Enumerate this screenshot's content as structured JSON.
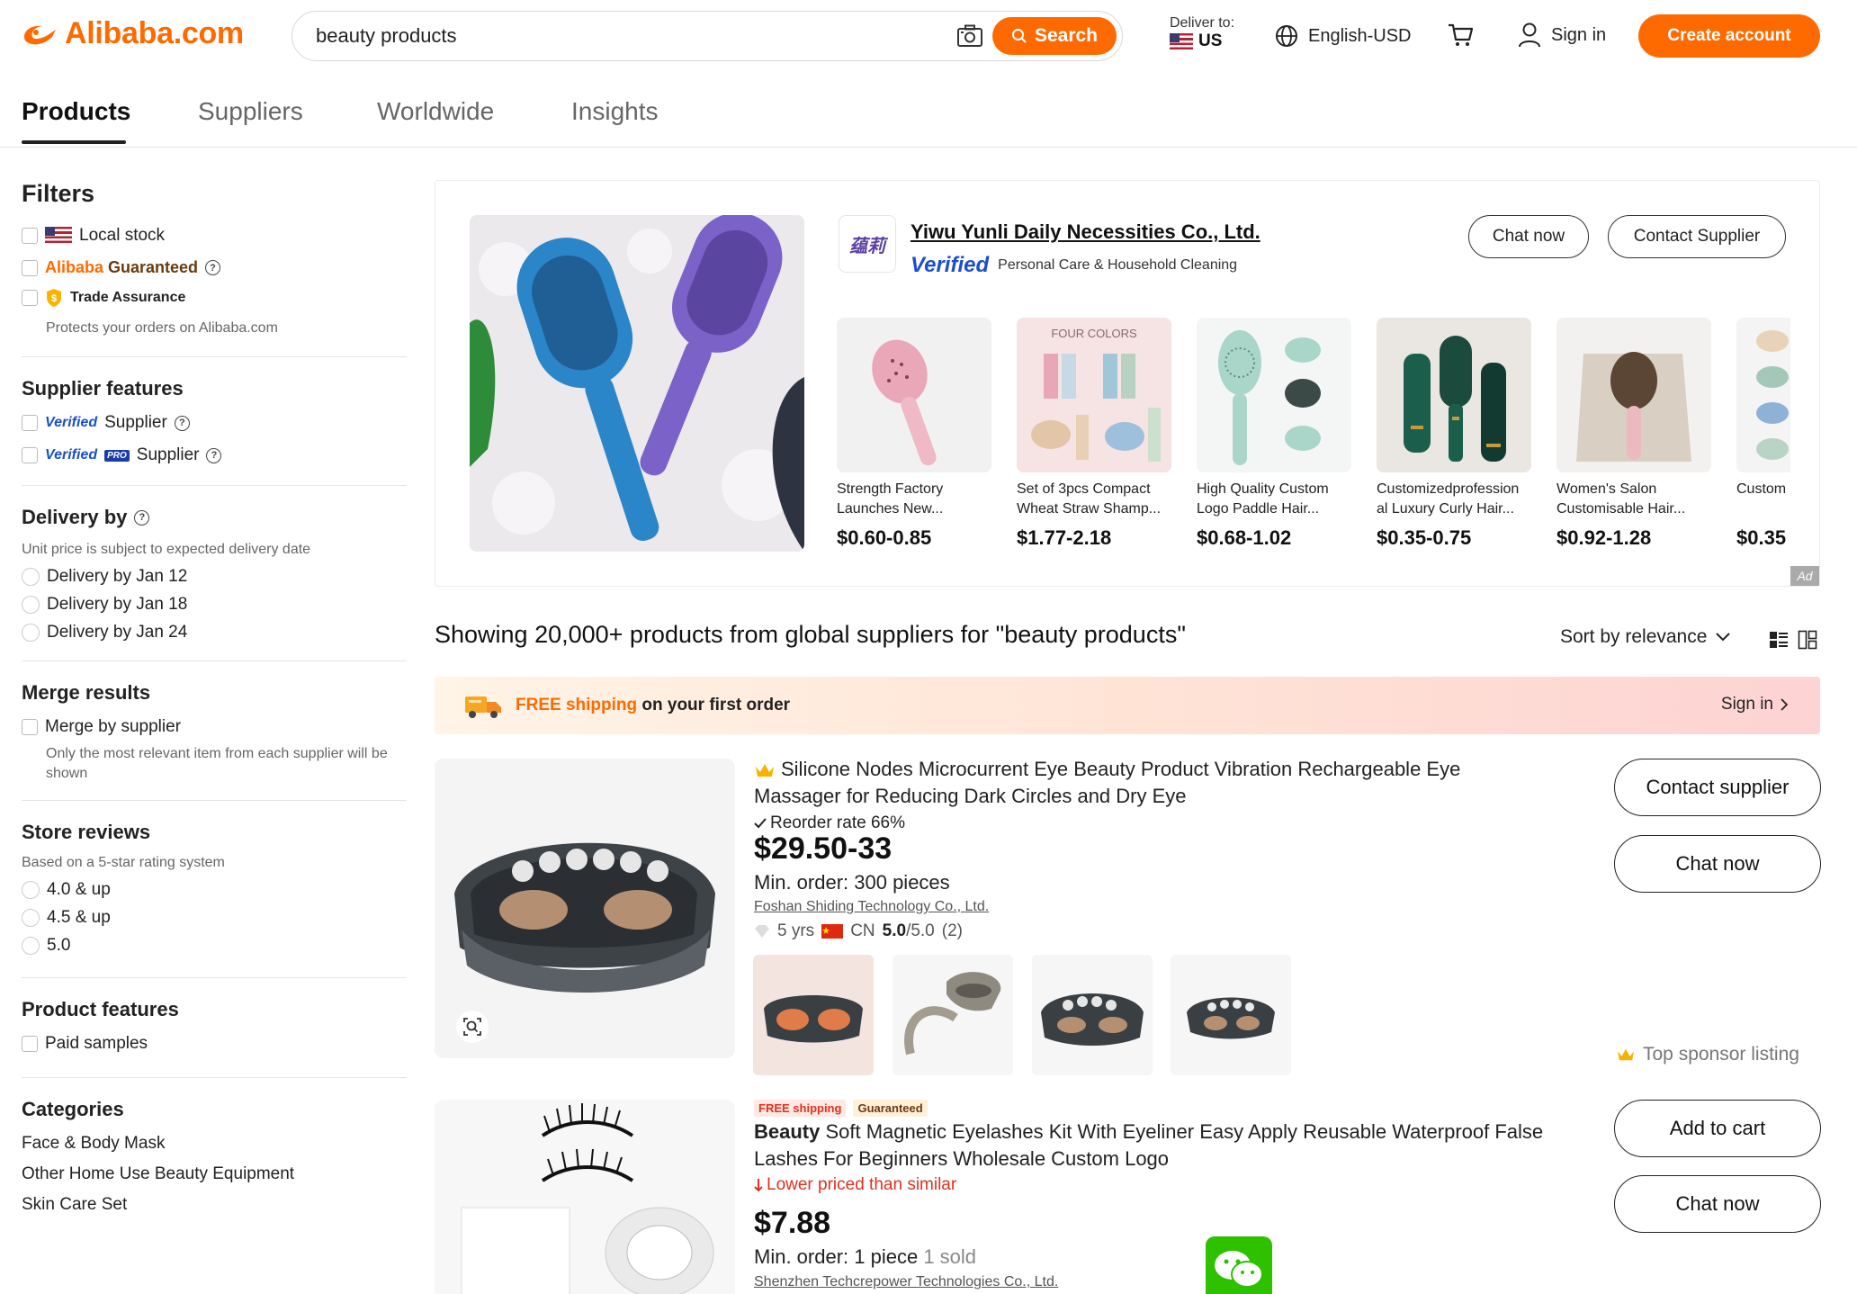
{
  "header": {
    "logo_text": "Alibaba.com",
    "search_value": "beauty products",
    "search_button": "Search",
    "deliver_label": "Deliver to:",
    "deliver_country": "US",
    "language": "English-USD",
    "sign_in": "Sign in",
    "create_account": "Create account"
  },
  "tabs": [
    "Products",
    "Suppliers",
    "Worldwide",
    "Insights"
  ],
  "sidebar": {
    "title": "Filters",
    "local_stock": "Local stock",
    "guaranteed_a": "Alibaba ",
    "guaranteed_b": "Guaranteed",
    "trade_assurance": "Trade Assurance",
    "trade_note": "Protects your orders on Alibaba.com",
    "supplier_features": "Supplier features",
    "verified": "Verified",
    "supplier": "Supplier",
    "pro": "PRO",
    "delivery_title": "Delivery by",
    "delivery_note": "Unit price is subject to expected delivery date",
    "delivery_options": [
      "Delivery by Jan 12",
      "Delivery by Jan 18",
      "Delivery by Jan 24"
    ],
    "merge_title": "Merge results",
    "merge_option": "Merge by supplier",
    "merge_note": "Only the most relevant item from each supplier will be shown",
    "reviews_title": "Store reviews",
    "reviews_note": "Based on a 5-star rating system",
    "review_options": [
      "4.0 & up",
      "4.5 & up",
      "5.0"
    ],
    "product_features_title": "Product features",
    "paid_samples": "Paid samples",
    "categories_title": "Categories",
    "categories": [
      "Face & Body Mask",
      "Other Home Use Beauty Equipment",
      "Skin Care Set"
    ]
  },
  "ad": {
    "supplier_name": "Yiwu Yunli Daily Necessities Co., Ltd.",
    "verified": "Verified",
    "category": "Personal Care & Household Cleaning",
    "chat_now": "Chat now",
    "contact_supplier": "Contact Supplier",
    "logo_text": "蕴莉",
    "ad_tag": "Ad",
    "four_colors": "FOUR COLORS",
    "products": [
      {
        "name": "Strength Factory Launches New...",
        "price": "$0.60-0.85"
      },
      {
        "name": "Set of 3pcs Compact Wheat Straw Shamp...",
        "price": "$1.77-2.18"
      },
      {
        "name": "High Quality Custom Logo Paddle Hair...",
        "price": "$0.68-1.02"
      },
      {
        "name": "Customizedprofession al Luxury Curly Hair...",
        "price": "$0.35-0.75"
      },
      {
        "name": "Women's Salon Customisable Hair...",
        "price": "$0.92-1.28"
      },
      {
        "name": "Custom Straw H",
        "price": "$0.35"
      }
    ]
  },
  "results": {
    "title": "Showing 20,000+ products from global suppliers for \"beauty products\"",
    "sort": "Sort by relevance"
  },
  "shipping_banner": {
    "free": "FREE shipping",
    "rest": " on your first order",
    "sign_in": "Sign in"
  },
  "listings": [
    {
      "title": "Silicone Nodes Microcurrent Eye Beauty Product Vibration Rechargeable Eye Massager for Reducing Dark Circles and Dry Eye",
      "reorder": "Reorder rate 66%",
      "price": "$29.50-33",
      "min_order": "Min. order: 300 pieces",
      "supplier": "Foshan Shiding Technology Co., Ltd.",
      "years": "5 yrs",
      "country": "CN",
      "rating": "5.0",
      "rating_total": "/5.0",
      "reviews": "(2)",
      "btn1": "Contact supplier",
      "btn2": "Chat now",
      "sponsor": "Top sponsor listing"
    },
    {
      "badge_free": "FREE shipping",
      "badge_guar": "Guaranteed",
      "title_bold": "Beauty",
      "title_rest": " Soft Magnetic Eyelashes Kit With Eyeliner Easy Apply Reusable Waterproof False Lashes For Beginners Wholesale Custom Logo",
      "lower": "Lower priced than similar",
      "price": "$7.88",
      "min_order": "Min. order: 1 piece",
      "sold": "1 sold",
      "supplier": "Shenzhen Techcrepower Technologies Co., Ltd.",
      "btn1": "Add to cart",
      "btn2": "Chat now"
    }
  ],
  "colors": {
    "accent": "#ff6a00",
    "verified": "#1a4ecf"
  }
}
